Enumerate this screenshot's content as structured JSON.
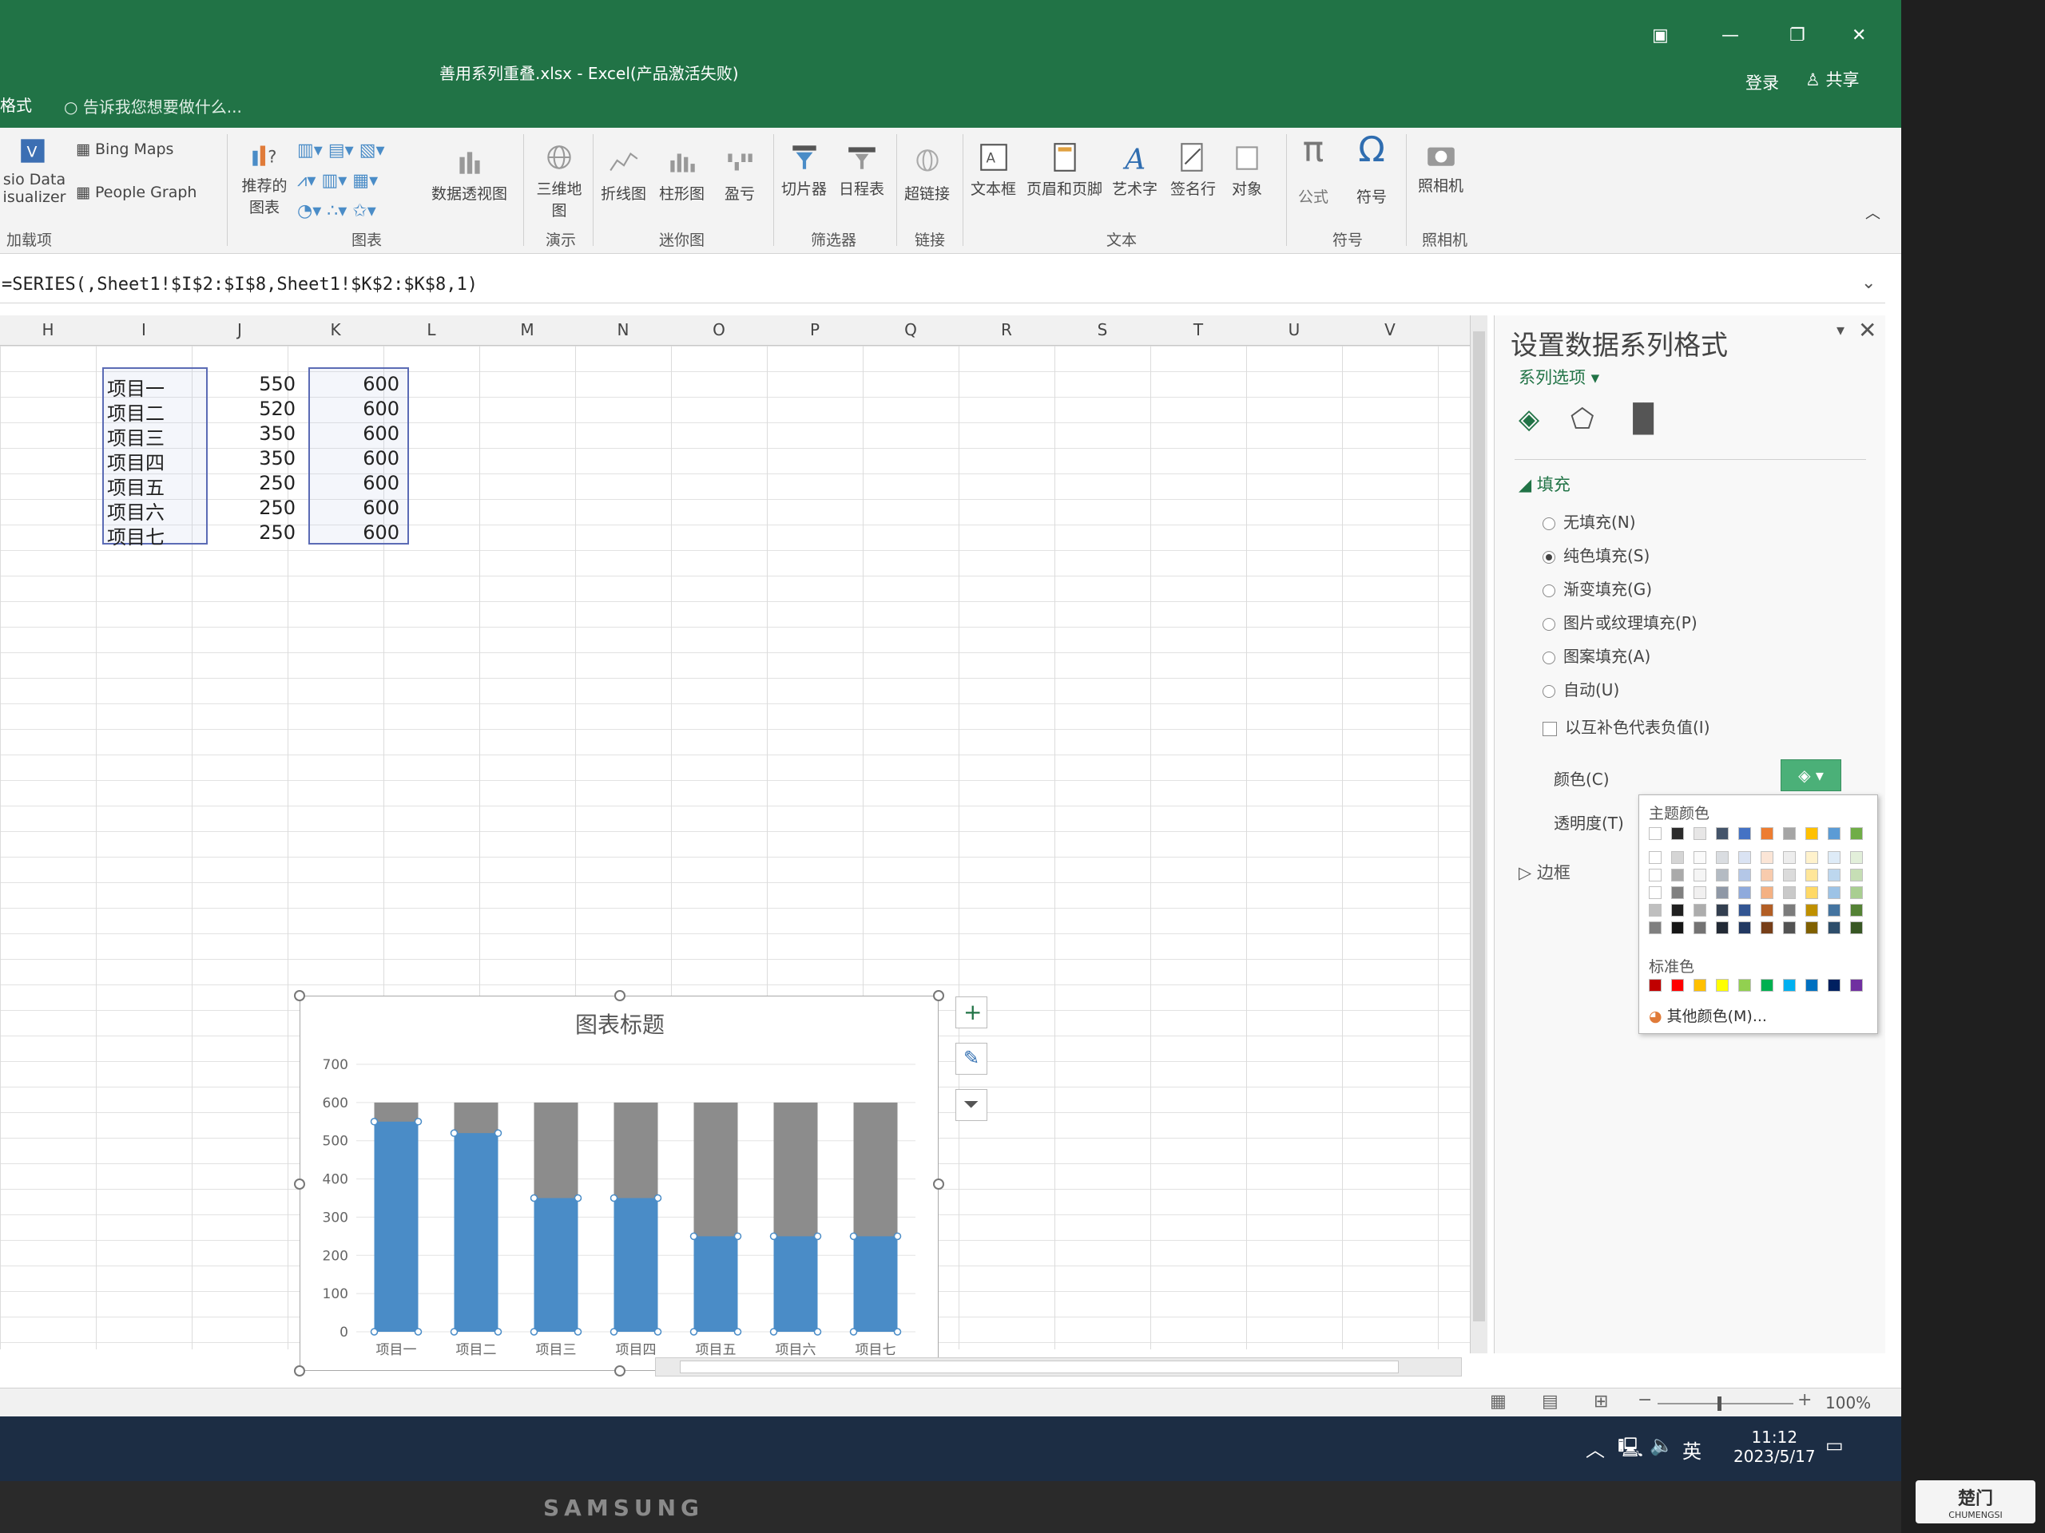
{
  "window": {
    "file_title": "善用系列重叠.xlsx - Excel(产品激活失败)",
    "left_tab": "格式",
    "tell_me": "告诉我您想要做什么...",
    "login": "登录",
    "share": "共享",
    "accent_color": "#217346"
  },
  "ribbon": {
    "addins": {
      "bing_maps": "Bing Maps",
      "people_graph": "People Graph",
      "visio_line1": "sio Data",
      "visio_line2": "isualizer",
      "group": "加载项"
    },
    "charts": {
      "recommended_line1": "推荐的",
      "recommended_line2": "图表",
      "pivot_chart": "数据透视图",
      "group": "图表"
    },
    "tours": {
      "map3d_line1": "三维地",
      "map3d_line2": "图",
      "group": "演示"
    },
    "sparklines": {
      "line": "折线图",
      "column": "柱形图",
      "winloss": "盈亏",
      "group": "迷你图"
    },
    "filters": {
      "slicer": "切片器",
      "timeline": "日程表",
      "group": "筛选器"
    },
    "links": {
      "hyperlink": "超链接",
      "group": "链接"
    },
    "text": {
      "textbox": "文本框",
      "header_footer": "页眉和页脚",
      "wordart": "艺术字",
      "signature": "签名行",
      "object": "对象",
      "group": "文本"
    },
    "symbols": {
      "equation": "公式",
      "symbol": "符号",
      "group": "符号"
    },
    "camera": {
      "camera": "照相机",
      "group": "照相机"
    }
  },
  "formula": "=SERIES(,Sheet1!$I$2:$I$8,Sheet1!$K$2:$K$8,1)",
  "sheet": {
    "columns": [
      "H",
      "I",
      "J",
      "K",
      "L",
      "M",
      "N",
      "O",
      "P",
      "Q",
      "R",
      "S",
      "T",
      "U",
      "V"
    ],
    "rows": [
      {
        "name": "项目一",
        "actual": "550",
        "target": "600"
      },
      {
        "name": "项目二",
        "actual": "520",
        "target": "600"
      },
      {
        "name": "项目三",
        "actual": "350",
        "target": "600"
      },
      {
        "name": "项目四",
        "actual": "350",
        "target": "600"
      },
      {
        "name": "项目五",
        "actual": "250",
        "target": "600"
      },
      {
        "name": "项目六",
        "actual": "250",
        "target": "600"
      },
      {
        "name": "项目七",
        "actual": "250",
        "target": "600"
      }
    ]
  },
  "chart_data": {
    "type": "bar",
    "title": "图表标题",
    "categories": [
      "项目一",
      "项目二",
      "项目三",
      "项目四",
      "项目五",
      "项目六",
      "项目七"
    ],
    "series": [
      {
        "values": [
          600,
          600,
          600,
          600,
          600,
          600,
          600
        ],
        "color": "#8c8c8c"
      },
      {
        "values": [
          550,
          520,
          350,
          350,
          250,
          250,
          250
        ],
        "color": "#4a8cc7"
      }
    ],
    "ylim": [
      0,
      700
    ],
    "yticks": [
      "0",
      "100",
      "200",
      "300",
      "400",
      "500",
      "600",
      "700"
    ],
    "grid": true,
    "overlap": true
  },
  "pane": {
    "title": "设置数据系列格式",
    "subtitle": "系列选项",
    "fill_section": "填充",
    "options": [
      "无填充(N)",
      "纯色填充(S)",
      "渐变填充(G)",
      "图片或纹理填充(P)",
      "图案填充(A)",
      "自动(U)"
    ],
    "selected_option": 1,
    "invert_label": "以互补色代表负值(I)",
    "color_label": "颜色(C)",
    "transparency_label": "透明度(T)",
    "border_section": "边框",
    "palette": {
      "theme_label": "主题颜色",
      "standard_label": "标准色",
      "more_colors": "其他颜色(M)...",
      "theme_colors": [
        "#ffffff",
        "#2b2b2b",
        "#e7e6e6",
        "#44546a",
        "#4472c4",
        "#ed7d31",
        "#a5a5a5",
        "#ffc000",
        "#5b9bd5",
        "#70ad47"
      ],
      "standard_colors": [
        "#c00000",
        "#ff0000",
        "#ffc000",
        "#ffff00",
        "#92d050",
        "#00b050",
        "#00b0f0",
        "#0070c0",
        "#002060",
        "#7030a0"
      ]
    }
  },
  "status": {
    "zoom": "100%"
  },
  "taskbar": {
    "time": "11:12",
    "date": "2023/5/17",
    "lang": "英"
  },
  "monitor_brand": "SAMSUNG",
  "watermark": {
    "big": "楚门",
    "small": "CHUMENGSI"
  }
}
